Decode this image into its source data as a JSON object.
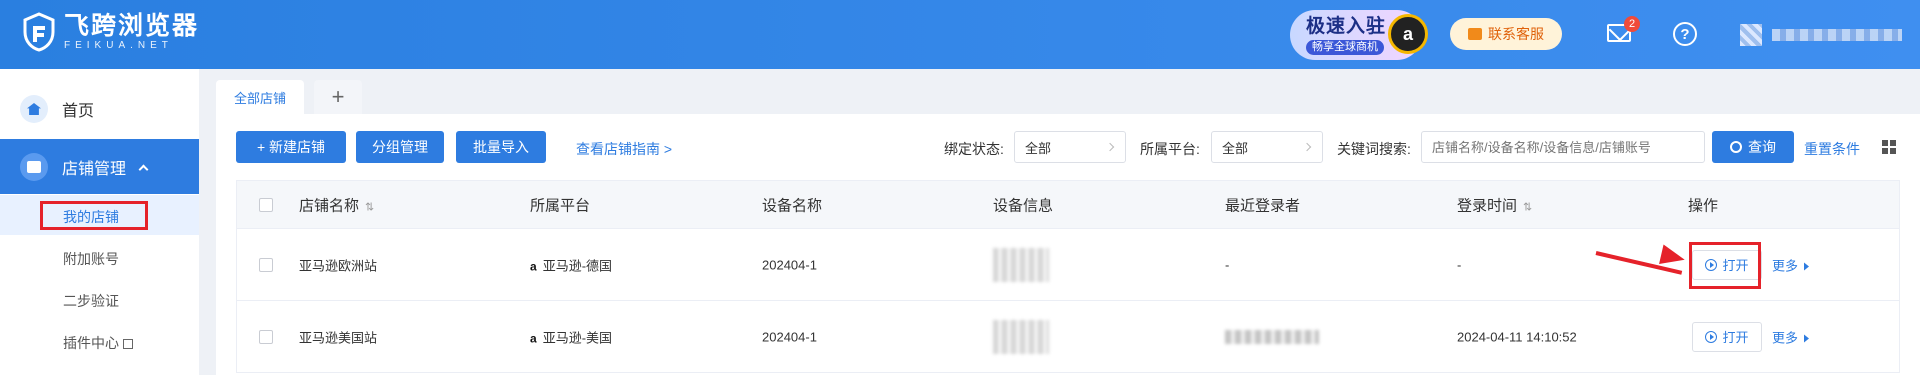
{
  "header": {
    "logo_cn": "飞跨浏览器",
    "logo_en": "FEIKUA.NET",
    "promo_title": "极速入驻",
    "promo_sub": "畅享全球商机",
    "promo_badge": "a",
    "contact_label": "联系客服",
    "mail_badge": "2",
    "help_symbol": "?"
  },
  "sidebar": {
    "home": "首页",
    "shop": "店铺管理",
    "sub_items": [
      "我的店铺",
      "附加账号",
      "二步验证",
      "插件中心"
    ]
  },
  "tabs": [
    {
      "label": "全部店铺"
    },
    {
      "label": "+"
    }
  ],
  "toolbar": {
    "new_shop": "+ 新建店铺",
    "group_manage": "分组管理",
    "batch_import": "批量导入",
    "guide_link": "查看店铺指南 >"
  },
  "filters": {
    "bind_label": "绑定状态:",
    "bind_value": "全部",
    "platform_label": "所属平台:",
    "platform_value": "全部",
    "keyword_label": "关键词搜索:",
    "keyword_placeholder": "店铺名称/设备名称/设备信息/店铺账号",
    "query": "查询",
    "reset": "重置条件"
  },
  "table": {
    "columns": [
      "店铺名称",
      "所属平台",
      "设备名称",
      "设备信息",
      "最近登录者",
      "登录时间",
      "操作"
    ],
    "sort_icon": "⇅",
    "rows": [
      {
        "name": "亚马逊欧洲站",
        "platform_icon": "a",
        "platform": "亚马逊-德国",
        "device": "202404-1",
        "last_user": "-",
        "login_time": "-",
        "open": "打开",
        "more": "更多"
      },
      {
        "name": "亚马逊美国站",
        "platform_icon": "a",
        "platform": "亚马逊-美国",
        "device": "202404-1",
        "last_user": "",
        "login_time": "2024-04-11 14:10:52",
        "open": "打开",
        "more": "更多"
      }
    ]
  },
  "colors": {
    "primary": "#2e7ce0",
    "annotation": "#e5222a",
    "header": "#3a8aec"
  }
}
